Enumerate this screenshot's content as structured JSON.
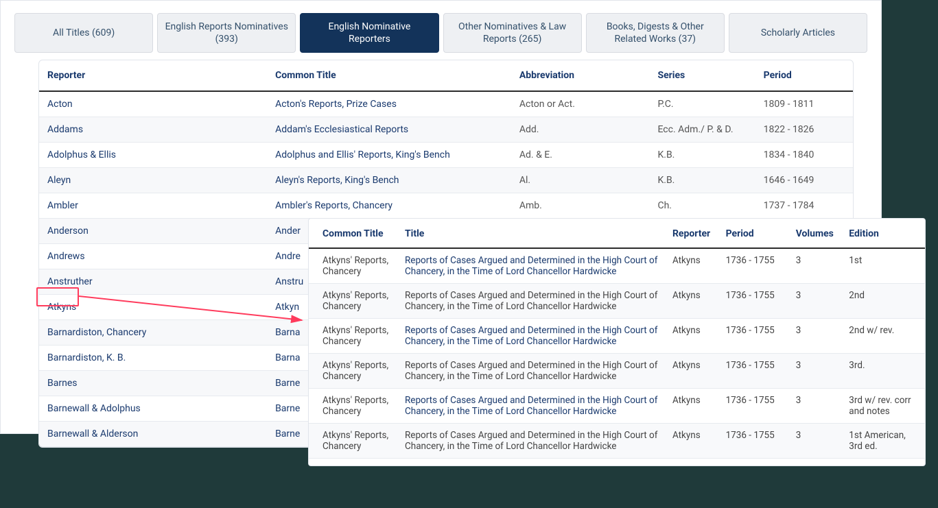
{
  "tabs": [
    {
      "label": "All Titles (609)"
    },
    {
      "label": "English Reports Nominatives (393)"
    },
    {
      "label": "English Nominative Reporters",
      "active": true
    },
    {
      "label": "Other Nominatives & Law Reports (265)"
    },
    {
      "label": "Books, Digests & Other Related Works (37)"
    },
    {
      "label": "Scholarly Articles"
    }
  ],
  "main_table": {
    "headers": {
      "reporter": "Reporter",
      "common_title": "Common Title",
      "abbr": "Abbreviation",
      "series": "Series",
      "period": "Period"
    },
    "rows": [
      {
        "reporter": "Acton",
        "common_title": "Acton's Reports, Prize Cases",
        "abbr": "Acton or Act.",
        "series": "P.C.",
        "period": "1809 - 1811"
      },
      {
        "reporter": "Addams",
        "common_title": "Addam's Ecclesiastical Reports",
        "abbr": "Add.",
        "series": "Ecc. Adm./ P. & D.",
        "period": "1822 - 1826"
      },
      {
        "reporter": "Adolphus & Ellis",
        "common_title": "Adolphus and Ellis' Reports, King's Bench",
        "abbr": "Ad. & E.",
        "series": "K.B.",
        "period": "1834 - 1840"
      },
      {
        "reporter": "Aleyn",
        "common_title": "Aleyn's Reports, King's Bench",
        "abbr": "Al.",
        "series": "K.B.",
        "period": "1646 - 1649"
      },
      {
        "reporter": "Ambler",
        "common_title": "Ambler's Reports, Chancery",
        "abbr": "Amb.",
        "series": "Ch.",
        "period": "1737 - 1784"
      },
      {
        "reporter": "Anderson",
        "common_title": "Ander",
        "abbr": "",
        "series": "",
        "period": ""
      },
      {
        "reporter": "Andrews",
        "common_title": "Andre",
        "abbr": "",
        "series": "",
        "period": ""
      },
      {
        "reporter": "Anstruther",
        "common_title": "Anstru",
        "abbr": "",
        "series": "",
        "period": ""
      },
      {
        "reporter": "Atkyns",
        "common_title": "Atkyn",
        "abbr": "",
        "series": "",
        "period": ""
      },
      {
        "reporter": "Barnardiston, Chancery",
        "common_title": "Barna",
        "abbr": "",
        "series": "",
        "period": ""
      },
      {
        "reporter": "Barnardiston, K. B.",
        "common_title": "Barna",
        "abbr": "",
        "series": "",
        "period": ""
      },
      {
        "reporter": "Barnes",
        "common_title": "Barne",
        "abbr": "",
        "series": "",
        "period": ""
      },
      {
        "reporter": "Barnewall & Adolphus",
        "common_title": "Barne",
        "abbr": "",
        "series": "",
        "period": ""
      },
      {
        "reporter": "Barnewall & Alderson",
        "common_title": "Barne",
        "abbr": "",
        "series": "",
        "period": ""
      }
    ]
  },
  "popup_table": {
    "headers": {
      "common_title": "Common Title",
      "title": "Title",
      "reporter": "Reporter",
      "period": "Period",
      "volumes": "Volumes",
      "edition": "Edition"
    },
    "rows": [
      {
        "common_title": "Atkyns' Reports, Chancery",
        "title": "Reports of Cases Argued and Determined in the High Court of Chancery, in the Time of Lord Chancellor Hardwicke",
        "reporter": "Atkyns",
        "period": "1736 - 1755",
        "volumes": "3",
        "edition": "1st",
        "link": true
      },
      {
        "common_title": "Atkyns' Reports, Chancery",
        "title": "Reports of Cases Argued and Determined in the High Court of Chancery, in the Time of Lord Chancellor Hardwicke",
        "reporter": "Atkyns",
        "period": "1736 - 1755",
        "volumes": "3",
        "edition": "2nd",
        "link": false
      },
      {
        "common_title": "Atkyns' Reports, Chancery",
        "title": "Reports of Cases Argued and Determined in the High Court of Chancery, in the Time of Lord Chancellor Hardwicke",
        "reporter": "Atkyns",
        "period": "1736 - 1755",
        "volumes": "3",
        "edition": "2nd w/ rev.",
        "link": true
      },
      {
        "common_title": "Atkyns' Reports, Chancery",
        "title": "Reports of Cases Argued and Determined in the High Court of Chancery, in the Time of Lord Chancellor Hardwicke",
        "reporter": "Atkyns",
        "period": "1736 - 1755",
        "volumes": "3",
        "edition": "3rd.",
        "link": false
      },
      {
        "common_title": "Atkyns' Reports, Chancery",
        "title": "Reports of Cases Argued and Determined in the High Court of Chancery, in the Time of Lord Chancellor Hardwicke",
        "reporter": "Atkyns",
        "period": "1736 - 1755",
        "volumes": "3",
        "edition": "3rd w/ rev. corr and notes",
        "link": true
      },
      {
        "common_title": "Atkyns' Reports, Chancery",
        "title": "Reports of Cases Argued and Determined in the High Court of Chancery, in the Time of Lord Chancellor Hardwicke",
        "reporter": "Atkyns",
        "period": "1736 - 1755",
        "volumes": "3",
        "edition": "1st American, 3rd ed.",
        "link": false
      }
    ],
    "col_widths": {
      "common_title": "14%",
      "title": "42%",
      "reporter": "8%",
      "period": "11%",
      "volumes": "8%",
      "edition": "13%"
    }
  }
}
